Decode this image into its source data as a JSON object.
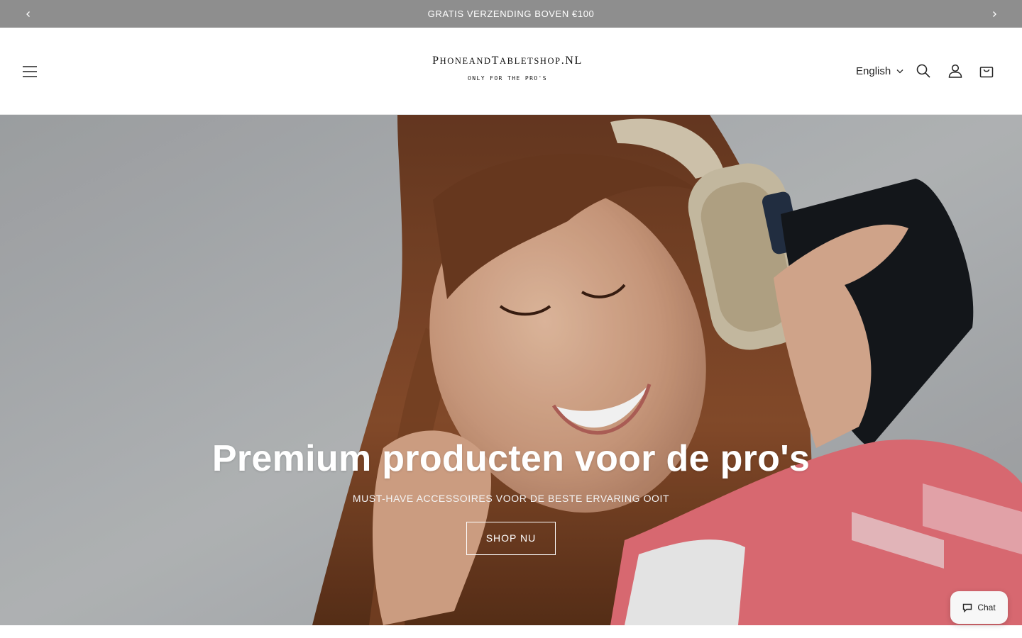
{
  "announcement": {
    "text": "GRATIS VERZENDING BOVEN €100",
    "prev_icon": "chevron-left-icon",
    "next_icon": "chevron-right-icon"
  },
  "header": {
    "menu_icon": "hamburger-menu-icon",
    "logo": {
      "main_parts": [
        "P",
        "HONE",
        "AND",
        "T",
        "ABLET",
        "SHOP",
        ".NL"
      ],
      "tagline": "ONLY FOR THE PRO'S"
    },
    "language": {
      "selected": "English",
      "icon": "chevron-down-icon"
    },
    "icons": {
      "search": "search-icon",
      "account": "account-icon",
      "cart": "cart-icon"
    }
  },
  "hero": {
    "title": "Premium producten voor de pro's",
    "subtitle": "MUST-HAVE ACCESSOIRES VOOR DE BESTE ERVARING OOIT",
    "button_label": "SHOP NU"
  },
  "chat": {
    "label": "Chat",
    "icon": "chat-bubble-icon"
  },
  "colors": {
    "announcement_bg": "#8e8e8e",
    "hero_text": "#ffffff",
    "header_bg": "#ffffff"
  }
}
